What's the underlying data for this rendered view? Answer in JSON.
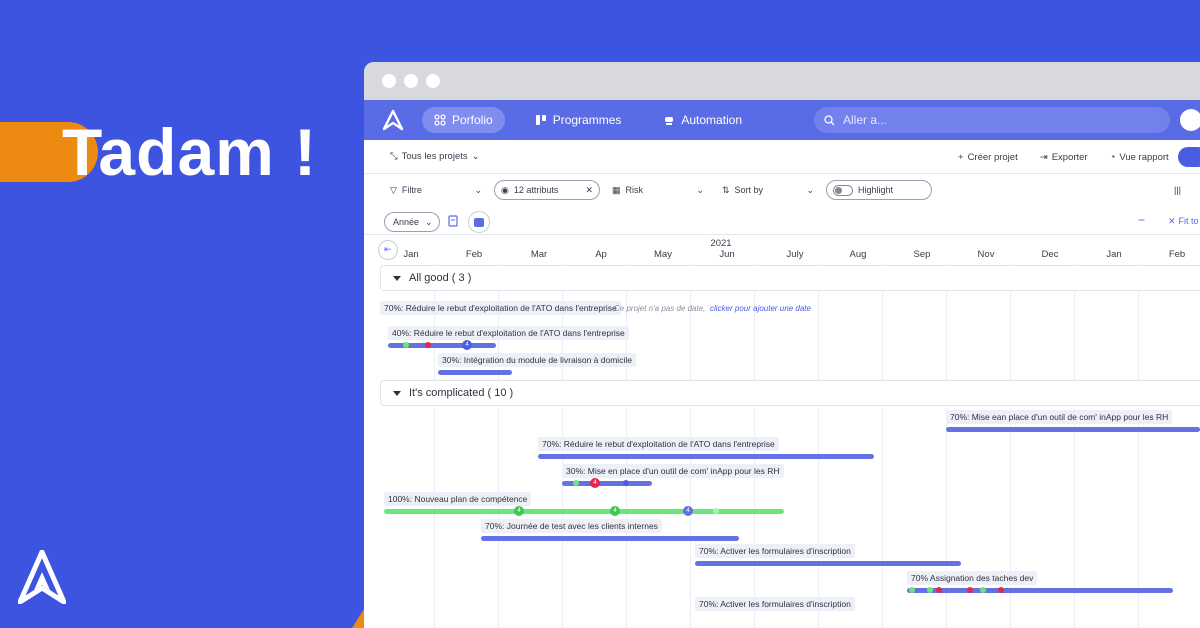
{
  "hero": {
    "title": "Tadam !"
  },
  "nav": {
    "tabs": [
      {
        "label": "Porfolio",
        "icon": "grid-icon"
      },
      {
        "label": "Programmes",
        "icon": "sliders-icon"
      },
      {
        "label": "Automation",
        "icon": "robot-icon"
      }
    ],
    "search_placeholder": "Aller a..."
  },
  "toolbar": {
    "all_projects": "Tous les projets",
    "create": "Créer projet",
    "export": "Exporter",
    "report": "Vue rapport"
  },
  "filters": {
    "filter": "Filtre",
    "attributes": "12 attributs",
    "risk": "Risk",
    "sort": "Sort by",
    "highlight": "Highlight",
    "fit": "Fit to"
  },
  "view": {
    "period": "Année"
  },
  "timeline": {
    "year": "2021",
    "months": [
      "Jan",
      "Feb",
      "Mar",
      "Ap",
      "May",
      "Jun",
      "July",
      "Aug",
      "Sep",
      "Nov",
      "Dec",
      "Jan",
      "Feb"
    ]
  },
  "groups": [
    {
      "label": "All good ( 3 )"
    },
    {
      "label": "It's complicated ( 10 )"
    }
  ],
  "tasks": {
    "t1": "70%: Réduire le rebut d'exploitation de l'ATO dans l'entreprise",
    "t1_note": "Ce projet n'a pas de date,",
    "t1_link": "clicker pour ajouter une date",
    "t2": "40%: Réduire le rebut d'exploitation de l'ATO dans l'entreprise",
    "t3": "30%: Intégration du module de livraison à domicile",
    "t4": "70%: Mise ean place d'un outil de com' inApp pour les RH",
    "t5": "70%: Réduire le rebut d'exploitation de l'ATO dans l'entreprise",
    "t6": "30%: Mise en place d'un outil de com' inApp pour les RH",
    "t7": "100%: Nouveau plan de compétence",
    "t8": "70%: Journée de test avec les clients internes",
    "t9": "70%: Activer les formulaires d'inscription",
    "t10": "70% Assignation des taches dev",
    "t11": "70%: Activer les formulaires d'inscription"
  },
  "colors": {
    "background": "#3d54e0",
    "accent": "#ed8a12",
    "nav": "#5a6be6",
    "bar_blue": "#6471e3",
    "bar_green": "#6ae67b",
    "marker_red": "#e8264e"
  }
}
